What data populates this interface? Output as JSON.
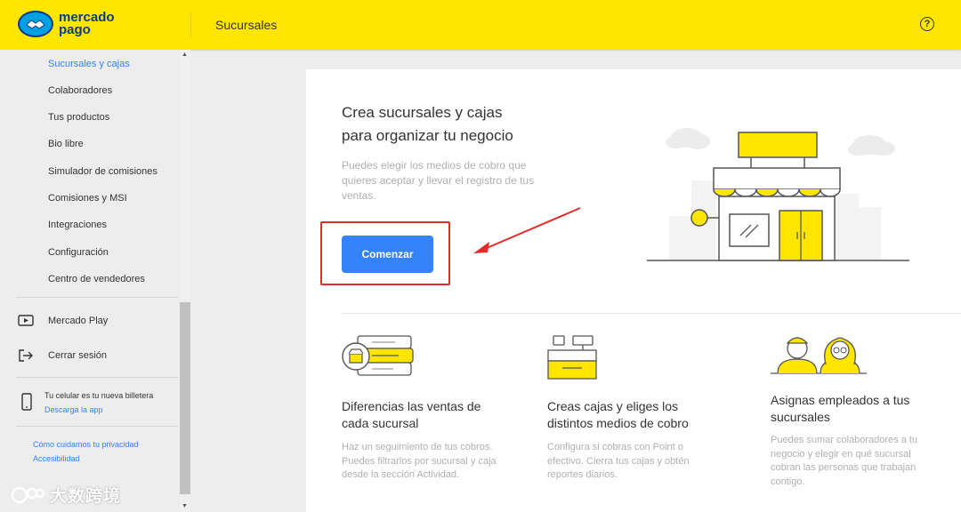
{
  "brand": {
    "line1": "mercado",
    "line2": "pago"
  },
  "header": {
    "title": "Sucursales",
    "help_symbol": "?"
  },
  "sidebar": {
    "items": [
      {
        "label": "Sucursales y cajas",
        "active": true
      },
      {
        "label": "Colaboradores"
      },
      {
        "label": "Tus productos"
      },
      {
        "label": "Bio libre"
      },
      {
        "label": "Simulador de comisiones"
      },
      {
        "label": "Comisiones y MSI"
      },
      {
        "label": "Integraciones"
      },
      {
        "label": "Configuración"
      },
      {
        "label": "Centro de vendedores"
      }
    ],
    "mercado_play": {
      "label": "Mercado Play",
      "icon": "play-icon"
    },
    "logout": {
      "label": "Cerrar sesión",
      "icon": "logout-icon"
    },
    "wallet": {
      "text": "Tu celular es tu nueva billetera",
      "link": "Descarga la app",
      "icon": "phone-icon"
    },
    "privacy_link": "Cómo cuidamos tu privacidad",
    "accessibility_link": "Accesibilidad"
  },
  "hero": {
    "title_line1": "Crea sucursales y cajas",
    "title_line2": "para organizar tu negocio",
    "desc_line1": "Puedes elegir los medios de cobro que",
    "desc_line2": "quieres aceptar y llevar el registro de tus",
    "desc_line3": "ventas.",
    "cta_label": "Comenzar"
  },
  "features": [
    {
      "title_line1": "Diferencias las ventas de",
      "title_line2": "cada sucursal",
      "desc_line1": "Haz un seguimiento de tus cobros.",
      "desc_line2": "Puedes filtrarlos por sucursal y caja",
      "desc_line3": "desde la sección Actividad."
    },
    {
      "title_line1": "Creas cajas y eliges los",
      "title_line2": "distintos medios de cobro",
      "desc_line1": "Configura si cobras con Point o",
      "desc_line2": "efectivo. Cierra tus cajas y obtén",
      "desc_line3": "reportes diarios."
    },
    {
      "title_line1": "Asignas empleados a tus",
      "title_line2": "sucursales",
      "desc_line1": "Puedes sumar colaboradores a tu",
      "desc_line2": "negocio y elegir en qué sucursal",
      "desc_line3": "cobran las personas que trabajan",
      "desc_line4": "contigo."
    }
  ],
  "watermark": {
    "text": "大数跨境"
  },
  "colors": {
    "accent": "#3483fa",
    "brand_yellow": "#ffe600",
    "highlight_red": "#e52b2b"
  }
}
